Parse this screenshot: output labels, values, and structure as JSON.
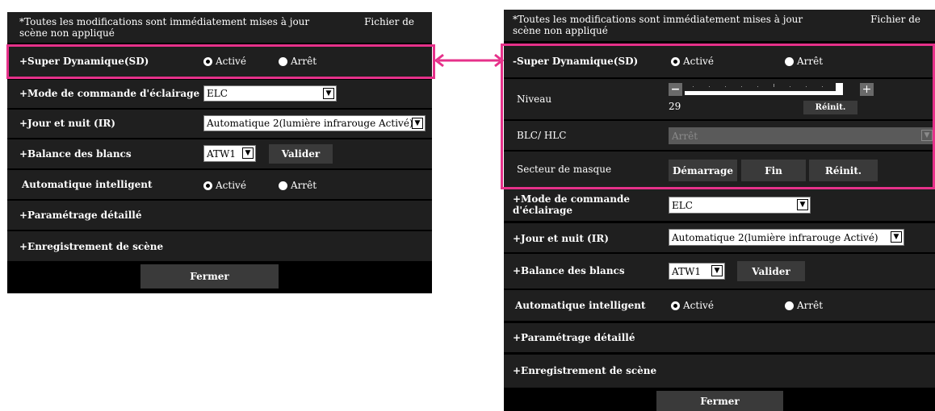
{
  "notice": {
    "text": "*Toutes les modifications sont immédiatement mises à jour",
    "file": "Fichier de",
    "file2": "scène non appliqué"
  },
  "left": {
    "sd": {
      "label": "+Super Dynamique(SD)",
      "on": "Activé",
      "off": "Arrêt"
    },
    "elc": {
      "label": "+Mode de commande d'éclairage",
      "value": "ELC"
    },
    "ir": {
      "label": "+Jour et nuit (IR)",
      "value": "Automatique 2(lumière infrarouge Activé)"
    },
    "wb": {
      "label": "+Balance des blancs",
      "value": "ATW1",
      "button": "Valider"
    },
    "ai": {
      "label": "Automatique intelligent",
      "on": "Activé",
      "off": "Arrêt"
    },
    "detail": {
      "label": "+Paramétrage détaillé"
    },
    "scene": {
      "label": "+Enregistrement de scène"
    },
    "close": "Fermer"
  },
  "right": {
    "sd": {
      "label": "-Super Dynamique(SD)",
      "on": "Activé",
      "off": "Arrêt"
    },
    "niveau": {
      "label": "Niveau",
      "minus": "−",
      "plus": "+",
      "value": "29",
      "reset": "Réinit.",
      "level_fraction": 0.9
    },
    "blc": {
      "label": "BLC/ HLC",
      "value": "Arrêt"
    },
    "mask": {
      "label": "Secteur de masque",
      "start": "Démarrage",
      "end": "Fin",
      "reset": "Réinit."
    },
    "elc": {
      "label": "+Mode de commande",
      "label2": "d'éclairage",
      "value": "ELC"
    },
    "ir": {
      "label": "+Jour et nuit (IR)",
      "value": "Automatique 2(lumière infrarouge Activé)"
    },
    "wb": {
      "label": "+Balance des blancs",
      "value": "ATW1",
      "button": "Valider"
    },
    "ai": {
      "label": "Automatique intelligent",
      "on": "Activé",
      "off": "Arrêt"
    },
    "detail": {
      "label": "+Paramétrage détaillé"
    },
    "scene": {
      "label": "+Enregistrement de scène"
    },
    "close": "Fermer"
  },
  "colors": {
    "highlight": "#e6318a",
    "row_bg": "#1f1f1f",
    "panel_bg": "#000000",
    "button_bg": "#3a3a3a"
  },
  "icons": {
    "arrow": "double-headed-arrow",
    "dropdown": "chevron-down"
  }
}
